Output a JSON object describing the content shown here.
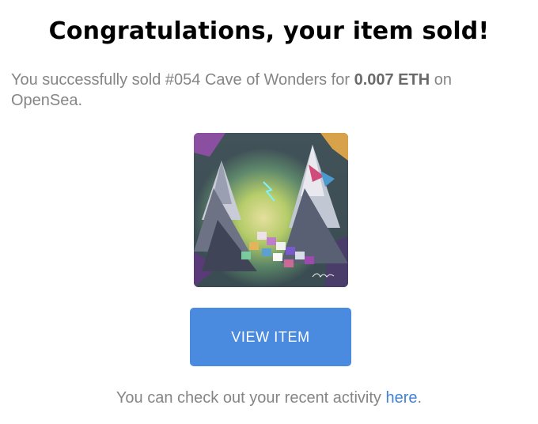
{
  "header": {
    "title": "Congratulations, your item sold!"
  },
  "message": {
    "prefix": "You successfully sold ",
    "item_name": "#054 Cave of Wonders",
    "middle": " for ",
    "price": "0.007 ETH",
    "suffix": " on OpenSea."
  },
  "image": {
    "icon": "nft-artwork-image"
  },
  "button": {
    "label": "VIEW ITEM"
  },
  "footer": {
    "text": "You can check out your recent activity ",
    "link_label": "here",
    "end": "."
  },
  "colors": {
    "button_bg": "#4a8be0",
    "link": "#3f82d6",
    "body_text": "#858585"
  }
}
